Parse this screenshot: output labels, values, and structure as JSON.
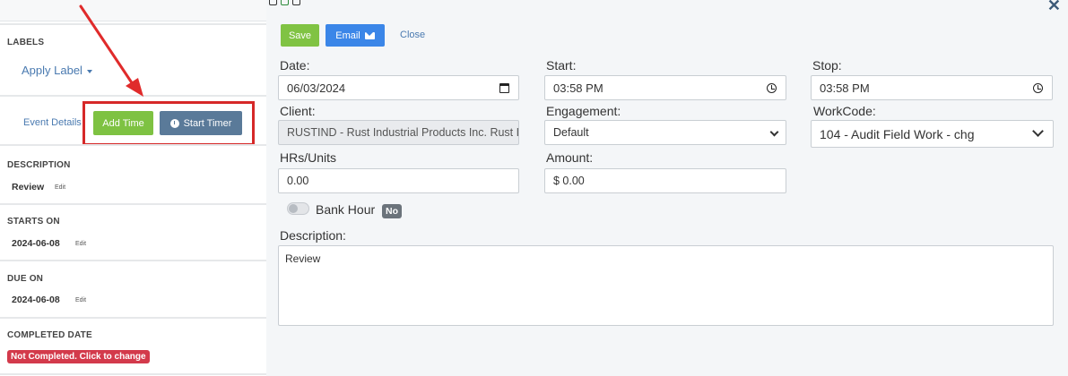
{
  "left": {
    "labels_heading": "LABELS",
    "apply_label": "Apply Label",
    "event_details": "Event Details",
    "add_time": "Add Time",
    "start_timer": "Start Timer",
    "description_heading": "DESCRIPTION",
    "description_value": "Review",
    "starts_on_heading": "STARTS ON",
    "starts_on_value": "2024-06-08",
    "due_on_heading": "DUE ON",
    "due_on_value": "2024-06-08",
    "completed_heading": "COMPLETED DATE",
    "completed_badge": "Not Completed. Click to change",
    "edit": "Edit"
  },
  "modal": {
    "save": "Save",
    "email": "Email",
    "close": "Close",
    "date_label": "Date:",
    "date_value": "06/03/2024",
    "start_label": "Start:",
    "start_value": "03:58 PM",
    "stop_label": "Stop:",
    "stop_value": "03:58 PM",
    "client_label": "Client:",
    "client_value": "RUSTIND - Rust Industrial Products Inc. Rust I",
    "engagement_label": "Engagement:",
    "engagement_value": "Default",
    "workcode_label": "WorkCode:",
    "workcode_value": "104 - Audit Field Work - chg",
    "hrs_label": "HRs/Units",
    "hrs_value": "0.00",
    "amount_label": "Amount:",
    "amount_value": "$ 0.00",
    "bank_hour_label": "Bank Hour",
    "bank_hour_badge": "No",
    "description_label": "Description:",
    "description_value": "Review"
  },
  "colors": {
    "green": "#80c343",
    "blue": "#3b86e8",
    "slate": "#5a7a99",
    "red_highlight": "#d62828",
    "badge_red": "#d33a4b"
  },
  "icons": [
    "clock-icon",
    "envelope-icon",
    "calendar-icon",
    "close-icon",
    "chevron-down-icon",
    "arrow-annotation"
  ]
}
